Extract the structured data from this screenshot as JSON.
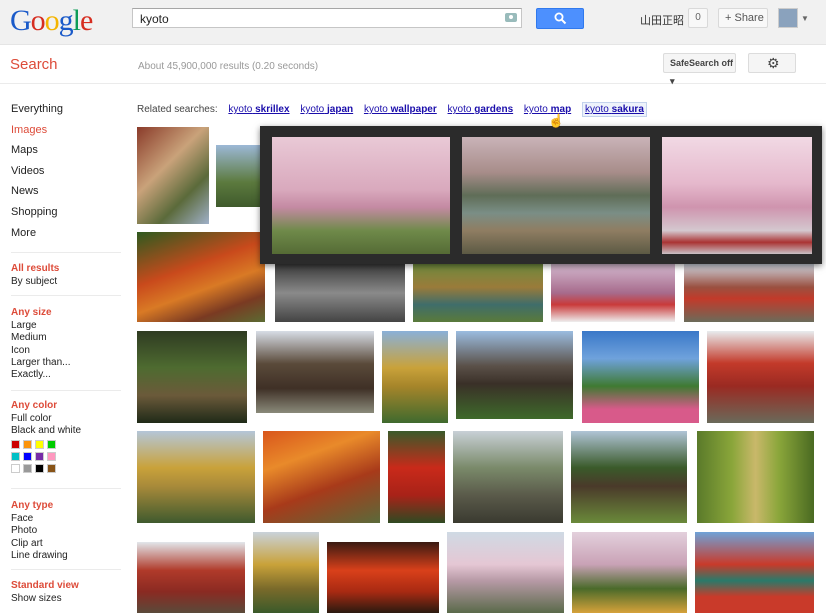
{
  "header": {
    "logo_letters": [
      {
        "ch": "G",
        "color": "#1a5ac9"
      },
      {
        "ch": "o",
        "color": "#d62d20"
      },
      {
        "ch": "o",
        "color": "#f4b400"
      },
      {
        "ch": "g",
        "color": "#1a5ac9"
      },
      {
        "ch": "l",
        "color": "#0f9d58"
      },
      {
        "ch": "e",
        "color": "#d62d20"
      }
    ],
    "query": "kyoto",
    "user_name": "山田正昭",
    "notification_count": "0",
    "share_label": "+ Share"
  },
  "toolbar": {
    "section_title": "Search",
    "result_stats": "About 45,900,000 results (0.20 seconds)",
    "safesearch_label": "SafeSearch off ▾"
  },
  "sidebar": {
    "nav": [
      "Everything",
      "Images",
      "Maps",
      "Videos",
      "News",
      "Shopping",
      "More"
    ],
    "active_nav": "Images",
    "results": {
      "all": "All results",
      "by_subject": "By subject"
    },
    "size": {
      "head": "Any size",
      "items": [
        "Large",
        "Medium",
        "Icon",
        "Larger than...",
        "Exactly..."
      ]
    },
    "color": {
      "head": "Any color",
      "items": [
        "Full color",
        "Black and white"
      ],
      "swatches": [
        "#cc0000",
        "#fb940b",
        "#ffff00",
        "#00cc00",
        "#03c0c6",
        "#0000ff",
        "#762ca7",
        "#ff98bf",
        "#ffffff",
        "#999999",
        "#000000",
        "#885418"
      ]
    },
    "type": {
      "head": "Any type",
      "items": [
        "Face",
        "Photo",
        "Clip art",
        "Line drawing"
      ]
    },
    "view": {
      "head": "Standard view",
      "items": [
        "Show sizes"
      ]
    }
  },
  "related": {
    "label": "Related searches:",
    "items": [
      {
        "prefix": "kyoto",
        "term": "skrillex"
      },
      {
        "prefix": "kyoto",
        "term": "japan"
      },
      {
        "prefix": "kyoto",
        "term": "wallpaper"
      },
      {
        "prefix": "kyoto",
        "term": "gardens"
      },
      {
        "prefix": "kyoto",
        "term": "map"
      },
      {
        "prefix": "kyoto",
        "term": "sakura"
      }
    ]
  },
  "colors": {
    "accent_red": "#dd4b39",
    "link_blue": "#1a0dab",
    "search_blue": "#4d90fe"
  }
}
